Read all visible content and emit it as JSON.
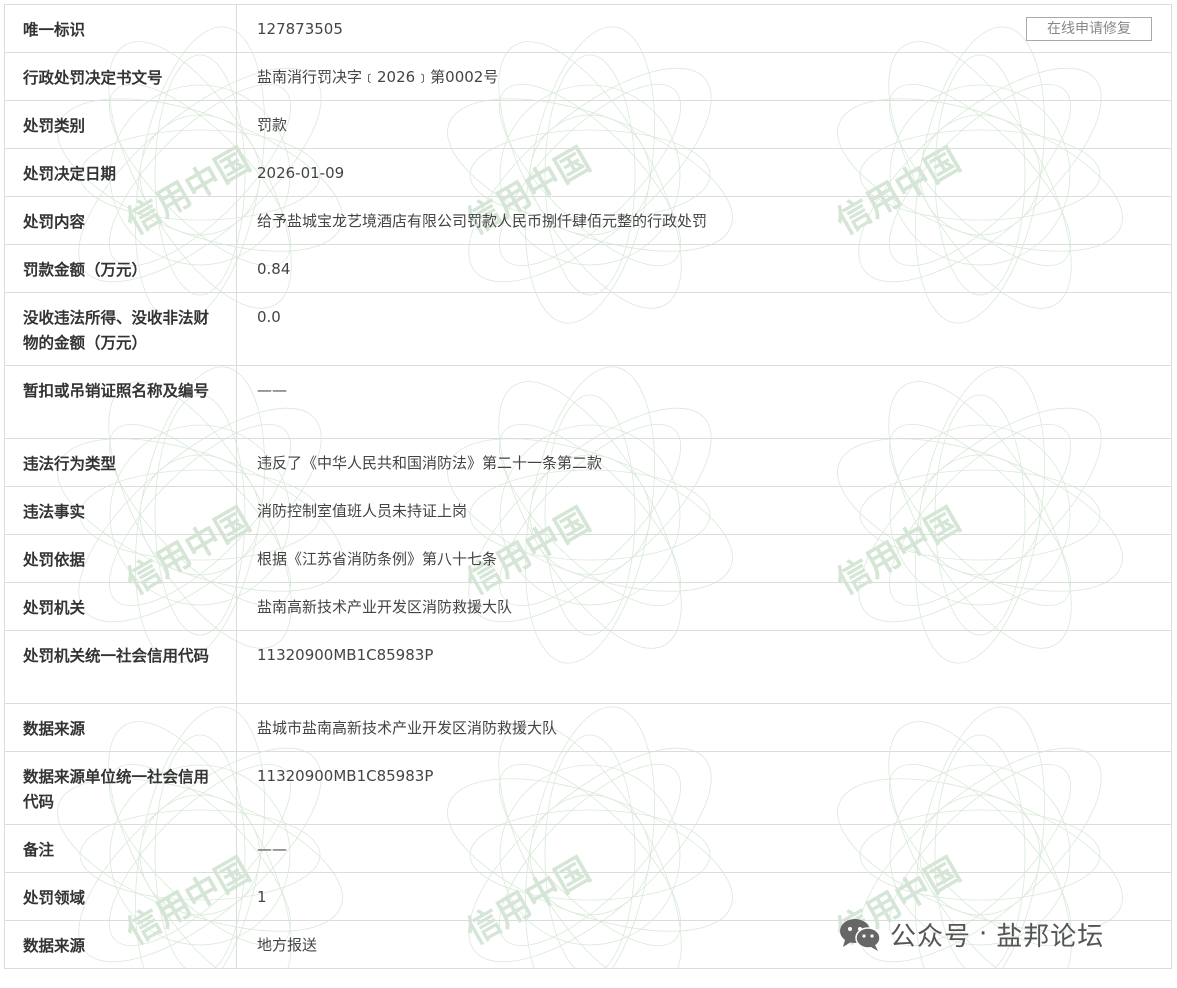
{
  "repair_button": "在线申请修复",
  "rows": [
    {
      "label": "唯一标识",
      "value": "127873505"
    },
    {
      "label": "行政处罚决定书文号",
      "value": "盐南消行罚决字﹝2026﹞第0002号"
    },
    {
      "label": "处罚类别",
      "value": "罚款"
    },
    {
      "label": "处罚决定日期",
      "value": "2026-01-09"
    },
    {
      "label": "处罚内容",
      "value": "给予盐城宝龙艺境酒店有限公司罚款人民币捌仟肆佰元整的行政处罚"
    },
    {
      "label": "罚款金额（万元）",
      "value": "0.84"
    },
    {
      "label": "没收违法所得、没收非法财物的金额（万元）",
      "value": "0.0"
    },
    {
      "label": "暂扣或吊销证照名称及编号",
      "value": "——"
    },
    {
      "label": "违法行为类型",
      "value": "违反了《中华人民共和国消防法》第二十一条第二款"
    },
    {
      "label": "违法事实",
      "value": "消防控制室值班人员未持证上岗"
    },
    {
      "label": "处罚依据",
      "value": "根据《江苏省消防条例》第八十七条"
    },
    {
      "label": "处罚机关",
      "value": "盐南高新技术产业开发区消防救援大队"
    },
    {
      "label": "处罚机关统一社会信用代码",
      "value": "11320900MB1C85983P"
    },
    {
      "label": "数据来源",
      "value": "盐城市盐南高新技术产业开发区消防救援大队"
    },
    {
      "label": "数据来源单位统一社会信用代码",
      "value": "11320900MB1C85983P"
    },
    {
      "label": "备注",
      "value": "——"
    },
    {
      "label": "处罚领域",
      "value": "1"
    },
    {
      "label": "数据来源",
      "value": "地方报送"
    }
  ],
  "watermark": {
    "text": "信用中国",
    "color": "#c8dcc8"
  },
  "wechat_mark": {
    "prefix": "公众号",
    "separator": "·",
    "account": "盐邦论坛"
  }
}
